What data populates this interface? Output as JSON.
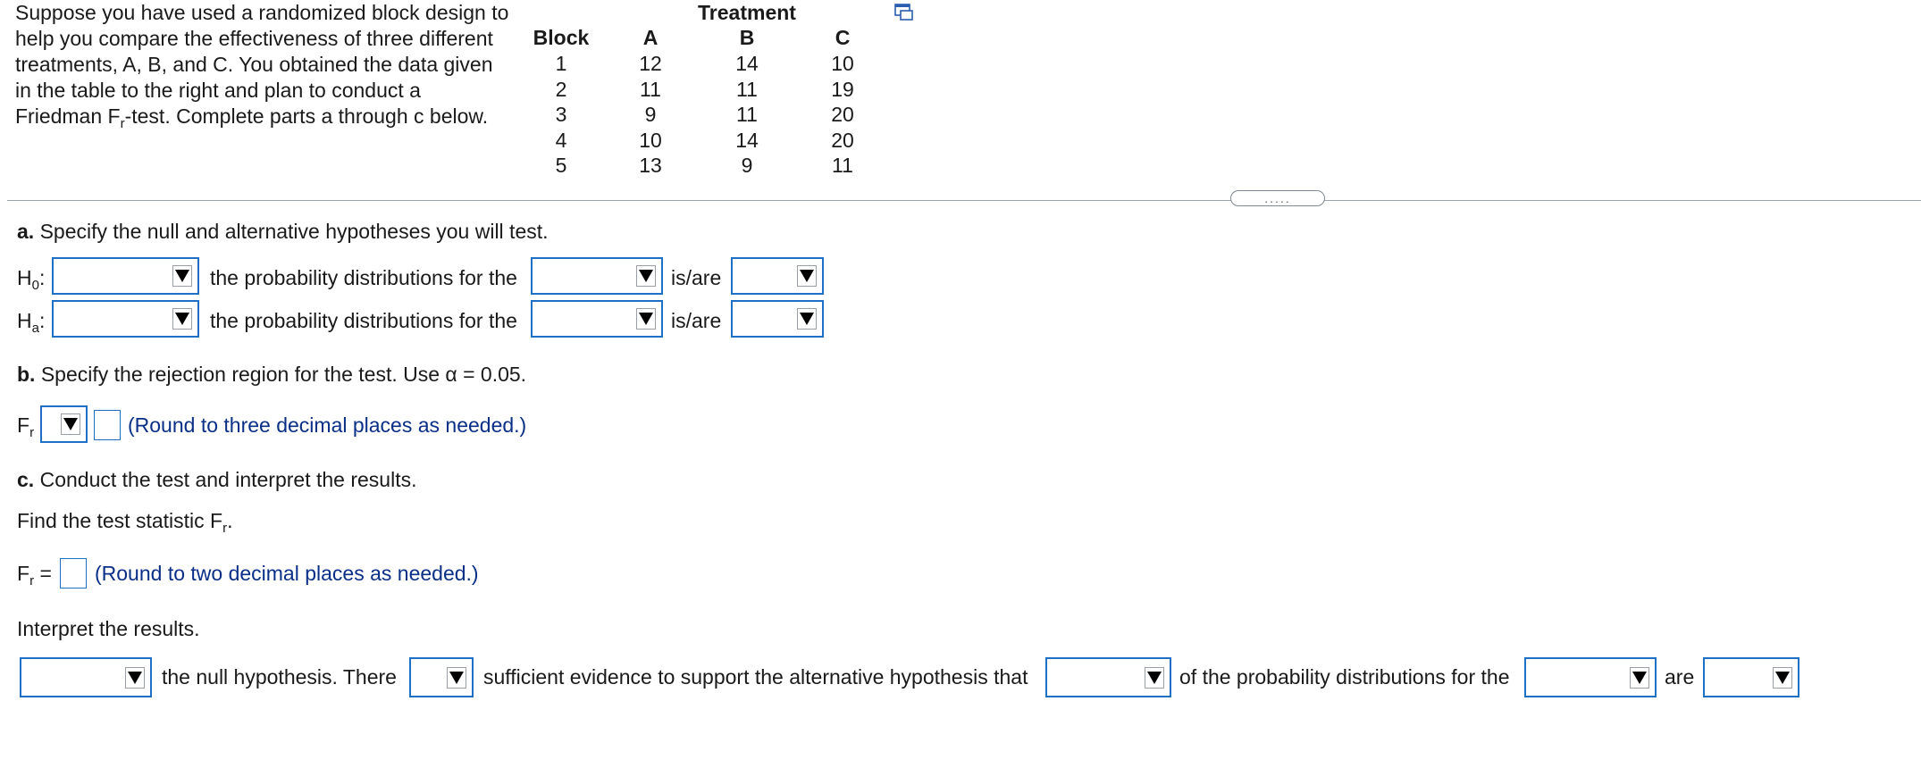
{
  "intro": {
    "line1": "Suppose you have used a randomized block design to",
    "line2": "help you compare the effectiveness of three different",
    "line3": "treatments, A, B, and C. You obtained the data given",
    "line4": "in the table to the right and plan to conduct a",
    "line5_pre": "Friedman F",
    "line5_sub": "r",
    "line5_post": "-test. Complete parts a through c below."
  },
  "table": {
    "group_header": "Treatment",
    "block_header": "Block",
    "columns": [
      "A",
      "B",
      "C"
    ],
    "rows": [
      {
        "block": "1",
        "A": "12",
        "B": "14",
        "C": "10"
      },
      {
        "block": "2",
        "A": "11",
        "B": "11",
        "C": "19"
      },
      {
        "block": "3",
        "A": "9",
        "B": "11",
        "C": "20"
      },
      {
        "block": "4",
        "A": "10",
        "B": "14",
        "C": "20"
      },
      {
        "block": "5",
        "A": "13",
        "B": "9",
        "C": "11"
      }
    ]
  },
  "divider": {
    "handle": "....."
  },
  "part_a": {
    "label": "a.",
    "text": "Specify the null and alternative hypotheses you will test.",
    "h0_symbol": "H",
    "h0_sub": "0",
    "ha_symbol": "H",
    "ha_sub": "a",
    "colon": ":",
    "phrase1": "the probability distributions for the",
    "phrase2": "is/are"
  },
  "part_b": {
    "label": "b.",
    "text": "Specify the rejection region for the test. Use α = 0.05.",
    "fr_symbol": "F",
    "fr_sub": "r",
    "hint": "(Round to three decimal places as needed.)"
  },
  "part_c": {
    "label": "c.",
    "text": "Conduct the test and interpret the results.",
    "find_pre": "Find the test statistic F",
    "find_sub": "r",
    "find_post": ".",
    "fr_symbol": "F",
    "fr_sub": "r",
    "equals": "=",
    "hint": "(Round to two decimal places as needed.)",
    "interpret": "Interpret the results.",
    "sentence1": "the null hypothesis. There",
    "sentence2": "sufficient evidence to support the alternative hypothesis that",
    "sentence3": "of the probability distributions for the",
    "sentence4": "are"
  },
  "icons": {
    "popout": "popout-window-icon",
    "dropdown_arrow": "triangle-down-icon"
  },
  "colors": {
    "input_border": "#1f6fc5",
    "hint_text": "#0a2f86",
    "divider": "#9aa3ad"
  }
}
